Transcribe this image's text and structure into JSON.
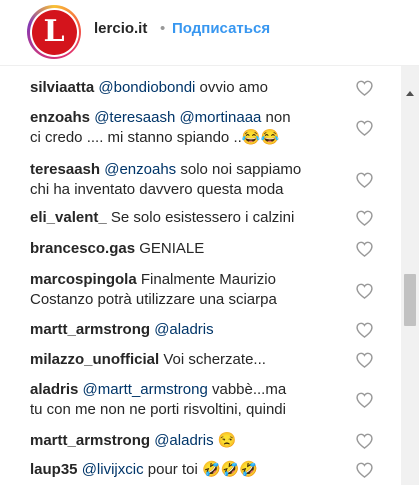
{
  "header": {
    "account": "lercio.it",
    "separator": "•",
    "follow_label": "Подписаться",
    "logo_letter": "L"
  },
  "comments": [
    {
      "user": "silviaatta",
      "mentions": "@bondiobondi",
      "text": " ovvio amo",
      "line2": ""
    },
    {
      "user": "enzoahs",
      "mentions": "@teresaash @mortinaaa",
      "text": " non",
      "line2": "ci credo .... mi stanno spiando ..😂😂"
    },
    {
      "user": "teresaash",
      "mentions": "@enzoahs",
      "text": " solo noi sappiamo",
      "line2": "chi ha inventato davvero questa moda"
    },
    {
      "user": "eli_valent_",
      "mentions": "",
      "text": " Se solo esistessero i calzini",
      "line2": ""
    },
    {
      "user": "brancesco.gas",
      "mentions": "",
      "text": " GENIALE",
      "line2": ""
    },
    {
      "user": "marcospingola",
      "mentions": "",
      "text": " Finalmente Maurizio",
      "line2": "Costanzo potrà utilizzare una sciarpa"
    },
    {
      "user": "martt_armstrong",
      "mentions": "@aladris",
      "text": "",
      "line2": ""
    },
    {
      "user": "milazzo_unofficial",
      "mentions": "",
      "text": " Voi scherzate...",
      "line2": ""
    },
    {
      "user": "aladris",
      "mentions": "@martt_armstrong",
      "text": " vabbè...ma",
      "line2": "tu con me non ne porti risvoltini, quindi"
    },
    {
      "user": "martt_armstrong",
      "mentions": "@aladris",
      "text": " 😒",
      "line2": ""
    },
    {
      "user": "laup35",
      "mentions": "@livijxcic",
      "text": " pour toi 🤣🤣🤣",
      "line2": ""
    }
  ],
  "icons": {
    "like": "heart-outline-icon",
    "scroll_up": "triangle-up-icon"
  },
  "colors": {
    "follow": "#3897f0",
    "mention": "#003569",
    "heart": "#999999",
    "logo": "#d4141c"
  }
}
